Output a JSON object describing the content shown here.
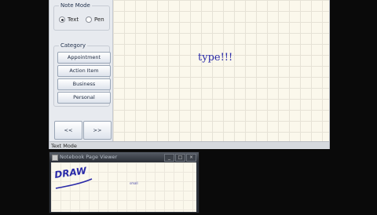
{
  "main_window": {
    "mode_group": {
      "legend": "Note Mode",
      "options": [
        "Text",
        "Pen"
      ],
      "selected": "Text"
    },
    "category_group": {
      "legend": "Category",
      "buttons": [
        "Appointment",
        "Action Item",
        "Business",
        "Personal"
      ]
    },
    "nav": {
      "prev_label": "<<",
      "next_label": ">>"
    },
    "canvas_text": "type!!!",
    "status": "Text Mode"
  },
  "second_window": {
    "title": "Notebook Page Viewer",
    "window_buttons": [
      "_",
      "□",
      "×"
    ],
    "drawing_text": "DRAW",
    "small_text": "small"
  },
  "colors": {
    "ink": "#2a2aa8",
    "paper": "#fbf8ec",
    "background": "#0a0a0a"
  }
}
